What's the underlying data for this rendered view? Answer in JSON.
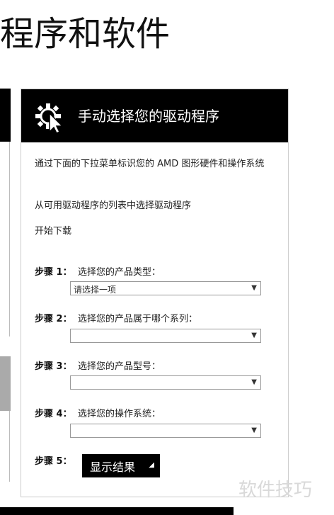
{
  "page": {
    "heading": "程序和软件"
  },
  "card": {
    "title": "手动选择您的驱动程序",
    "intro": "通过下面的下拉菜单标识您的 AMD 图形硬件和操作系统",
    "line2": "从可用驱动程序的列表中选择驱动程序",
    "line3": "开始下载",
    "steps": [
      {
        "label": "步骤 1：",
        "text": "选择您的产品类型：",
        "value": "请选择一项"
      },
      {
        "label": "步骤 2：",
        "text": "选择您的产品属于哪个系列：",
        "value": ""
      },
      {
        "label": "步骤 3：",
        "text": "选择您的产品型号：",
        "value": ""
      },
      {
        "label": "步骤 4：",
        "text": "选择您的操作系统：",
        "value": ""
      },
      {
        "label": "步骤 5："
      }
    ],
    "button_label": "显示结果"
  },
  "watermark": "软件技巧"
}
